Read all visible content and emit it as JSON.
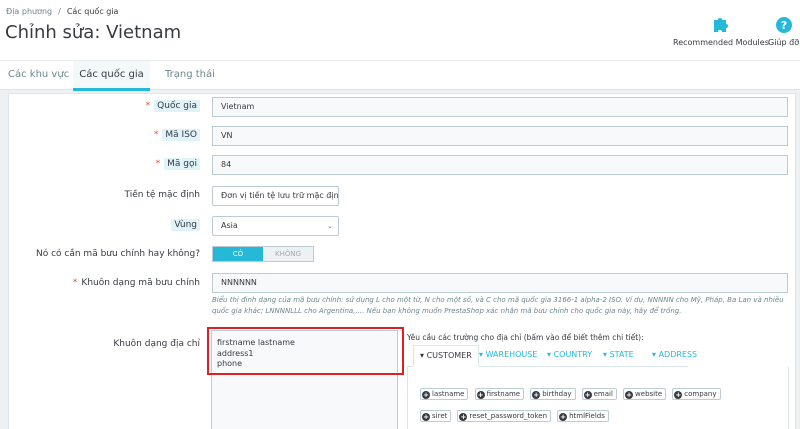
{
  "header": {
    "breadcrumb": [
      "Địa phương",
      "Các quốc gia"
    ],
    "breadcrumb_sep": "/",
    "title": "Chỉnh sửa: Vietnam",
    "toolbar": {
      "modules_label": "Recommended Modules",
      "help_label": "Giúp đỡ"
    }
  },
  "tabs": [
    {
      "label": "Các khu vực",
      "active": false
    },
    {
      "label": "Các quốc gia",
      "active": true
    },
    {
      "label": "Trạng thái",
      "active": false
    }
  ],
  "form": {
    "country_label": "Quốc gia",
    "country_value": "Vietnam",
    "iso_label": "Mã ISO",
    "iso_value": "VN",
    "call_prefix_label": "Mã gọi",
    "call_prefix_value": "84",
    "currency_label": "Tiền tệ mặc định",
    "currency_value": "Đơn vị tiền tệ lưu trữ mặc định",
    "zone_label": "Vùng",
    "zone_value": "Asia",
    "need_zip_label": "Nó có cần mã bưu chính hay không?",
    "toggle_yes": "CÓ",
    "toggle_no": "KHÔNG",
    "zip_format_label": "Khuôn dạng mã bưu chính",
    "zip_format_value": "NNNNNN",
    "zip_help": "Biểu thị định dạng của mã bưu chính: sử dụng L cho một từ, N cho một số, và C cho mã quốc gia 3166-1 alpha-2 ISO. Ví dụ, NNNNN cho Mỹ, Pháp, Ba Lan và nhiều quốc gia khác; LNNNNLLL cho Argentina,.... Nếu bạn không muốn PrestaShop xác nhận mã bưu chính cho quốc gia này, hãy để trống.",
    "address_format_label": "Khuôn dạng địa chỉ",
    "address_lines": [
      "firstname lastname",
      "address1",
      "phone"
    ]
  },
  "address_fields": {
    "title": "Yêu cầu các trường cho địa chỉ (bấm vào để biết thêm chi tiết):",
    "tabs": [
      "Customer",
      "Warehouse",
      "Country",
      "State",
      "Address"
    ],
    "chips": [
      "lastname",
      "firstname",
      "birthday",
      "email",
      "website",
      "company",
      "siret",
      "reset_password_token",
      "htmlFields"
    ]
  },
  "colors": {
    "accent": "#25b9d7",
    "required": "#f54c3e",
    "highlight": "#e02020"
  }
}
